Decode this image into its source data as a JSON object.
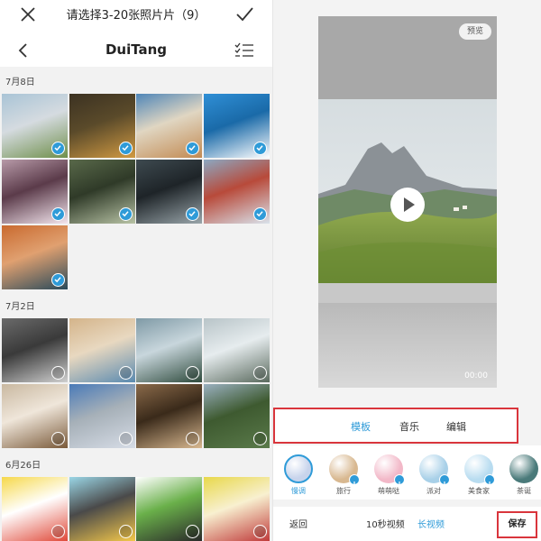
{
  "picker": {
    "title": "请选择3-20张照片片（9）",
    "album": "DuiTang",
    "sections": [
      {
        "date": "7月8日",
        "photos": [
          {
            "selected": true,
            "colors": [
              "#a9c4d6",
              "#6f8f4b",
              "#d5dbe0"
            ]
          },
          {
            "selected": true,
            "colors": [
              "#3c3222",
              "#d19a42",
              "#5a4a2a"
            ]
          },
          {
            "selected": true,
            "colors": [
              "#4f86b8",
              "#c28a52",
              "#e0d6c2"
            ]
          },
          {
            "selected": true,
            "colors": [
              "#2f8fd6",
              "#ffffff",
              "#1a6aa8"
            ]
          },
          {
            "selected": true,
            "colors": [
              "#b79aa8",
              "#f4e6ee",
              "#5b3b4a"
            ]
          },
          {
            "selected": true,
            "colors": [
              "#59694a",
              "#b9c4a6",
              "#2f3a28"
            ]
          },
          {
            "selected": true,
            "colors": [
              "#3e4a50",
              "#9aa6ab",
              "#1e2428"
            ]
          },
          {
            "selected": true,
            "colors": [
              "#8ba8c2",
              "#d9e3ec",
              "#b84a3a"
            ]
          },
          {
            "selected": true,
            "colors": [
              "#c96a2f",
              "#2a4a5a",
              "#e0a070"
            ]
          }
        ]
      },
      {
        "date": "7月2日",
        "photos": [
          {
            "selected": false,
            "colors": [
              "#6a6a6a",
              "#d0d0d0",
              "#3a3a3a"
            ]
          },
          {
            "selected": false,
            "colors": [
              "#d4b48a",
              "#5a8ab0",
              "#e8d8c0"
            ]
          },
          {
            "selected": false,
            "colors": [
              "#7f9aa6",
              "#2e4a3c",
              "#c8d6dc"
            ]
          },
          {
            "selected": false,
            "colors": [
              "#b8c4c8",
              "#5a6a5e",
              "#e6ecee"
            ]
          },
          {
            "selected": false,
            "colors": [
              "#c9b8a0",
              "#7a5a3a",
              "#efe6da"
            ]
          },
          {
            "selected": false,
            "colors": [
              "#4a7ab8",
              "#d6dce6",
              "#a6b0b8"
            ]
          },
          {
            "selected": false,
            "colors": [
              "#8a6a4a",
              "#d8b890",
              "#3a2a1a"
            ]
          },
          {
            "selected": false,
            "colors": [
              "#9ab0c0",
              "#5a7a4a",
              "#3e5a30"
            ]
          }
        ]
      },
      {
        "date": "6月26日",
        "photos": [
          {
            "selected": false,
            "colors": [
              "#f6d84a",
              "#e04a3a",
              "#ffffff"
            ]
          },
          {
            "selected": false,
            "colors": [
              "#9ad6e6",
              "#f4c84a",
              "#4a4a4a"
            ]
          },
          {
            "selected": false,
            "colors": [
              "#ffffff",
              "#2a2a2a",
              "#6ab04a"
            ]
          },
          {
            "selected": false,
            "colors": [
              "#e8d84a",
              "#c03a3a",
              "#f8f0d0"
            ]
          }
        ]
      }
    ]
  },
  "editor": {
    "preview_button": "预览",
    "time": "00:00",
    "tabs": [
      "模板",
      "音乐",
      "编辑"
    ],
    "active_tab": 0,
    "filters": [
      {
        "label": "慢调",
        "color": "#c8d4ec",
        "active": true,
        "download": false
      },
      {
        "label": "旅行",
        "color": "#d8b890",
        "active": false,
        "download": true
      },
      {
        "label": "萌萌哒",
        "color": "#f2b8c8",
        "active": false,
        "download": true
      },
      {
        "label": "派对",
        "color": "#a8d0e8",
        "active": false,
        "download": true
      },
      {
        "label": "美食家",
        "color": "#b8dcf0",
        "active": false,
        "download": true
      },
      {
        "label": "茶诞",
        "color": "#4a7a7a",
        "active": false,
        "download": false
      }
    ],
    "back_label": "返回",
    "mode_short": "10秒视频",
    "mode_long": "长视频",
    "save_label": "保存"
  },
  "colors": {
    "accent": "#2f9bd8",
    "highlight": "#d9353c"
  }
}
